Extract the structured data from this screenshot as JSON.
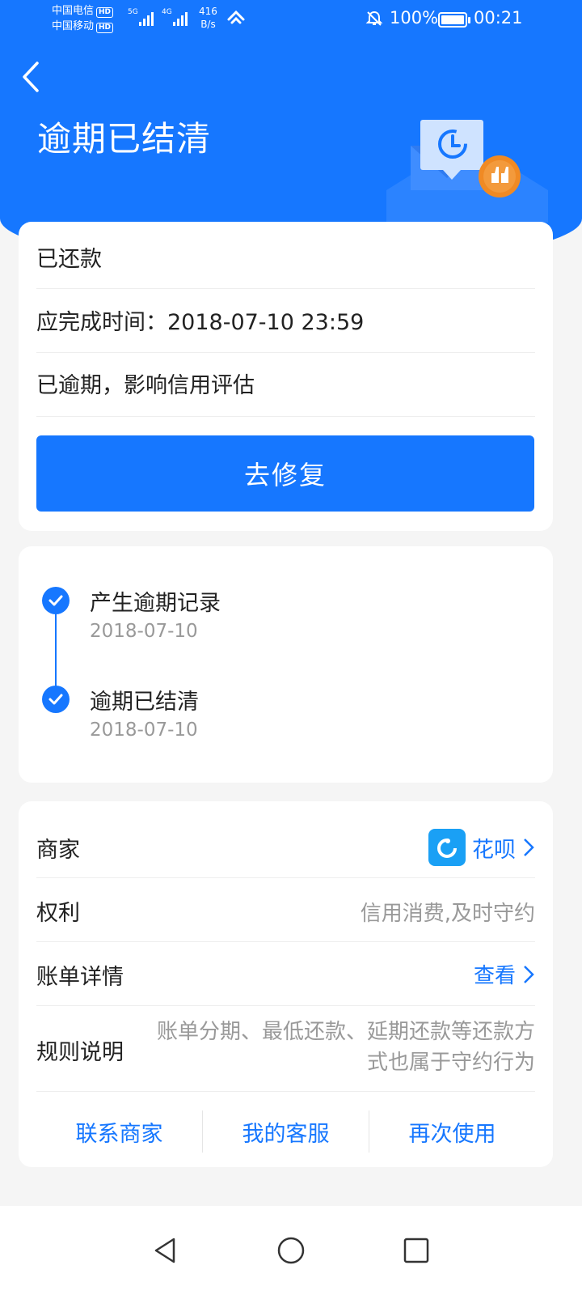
{
  "status_bar": {
    "carrier1": "中国电信",
    "carrier2": "中国移动",
    "hd": "HD",
    "sig1": "5G",
    "sig2": "4G",
    "speed_value": "416",
    "speed_unit": "B/s",
    "battery": "100%",
    "time": "00:21"
  },
  "header": {
    "title": "逾期已结清"
  },
  "status_card": {
    "repaid": "已还款",
    "due_time": "应完成时间：2018-07-10 23:59",
    "overdue_note": "已逾期，影响信用评估",
    "fix_button": "去修复"
  },
  "timeline": [
    {
      "title": "产生逾期记录",
      "date": "2018-07-10"
    },
    {
      "title": "逾期已结清",
      "date": "2018-07-10"
    }
  ],
  "details": {
    "merchant_label": "商家",
    "merchant_value": "花呗",
    "rights_label": "权利",
    "rights_value": "信用消费,及时守约",
    "bill_label": "账单详情",
    "bill_value": "查看",
    "rules_label": "规则说明",
    "rules_value": "账单分期、最低还款、延期还款等还款方式也属于守约行为"
  },
  "actions": {
    "contact_merchant": "联系商家",
    "my_service": "我的客服",
    "use_again": "再次使用"
  },
  "colors": {
    "primary": "#1677ff",
    "accent_orange": "#f08a24"
  }
}
